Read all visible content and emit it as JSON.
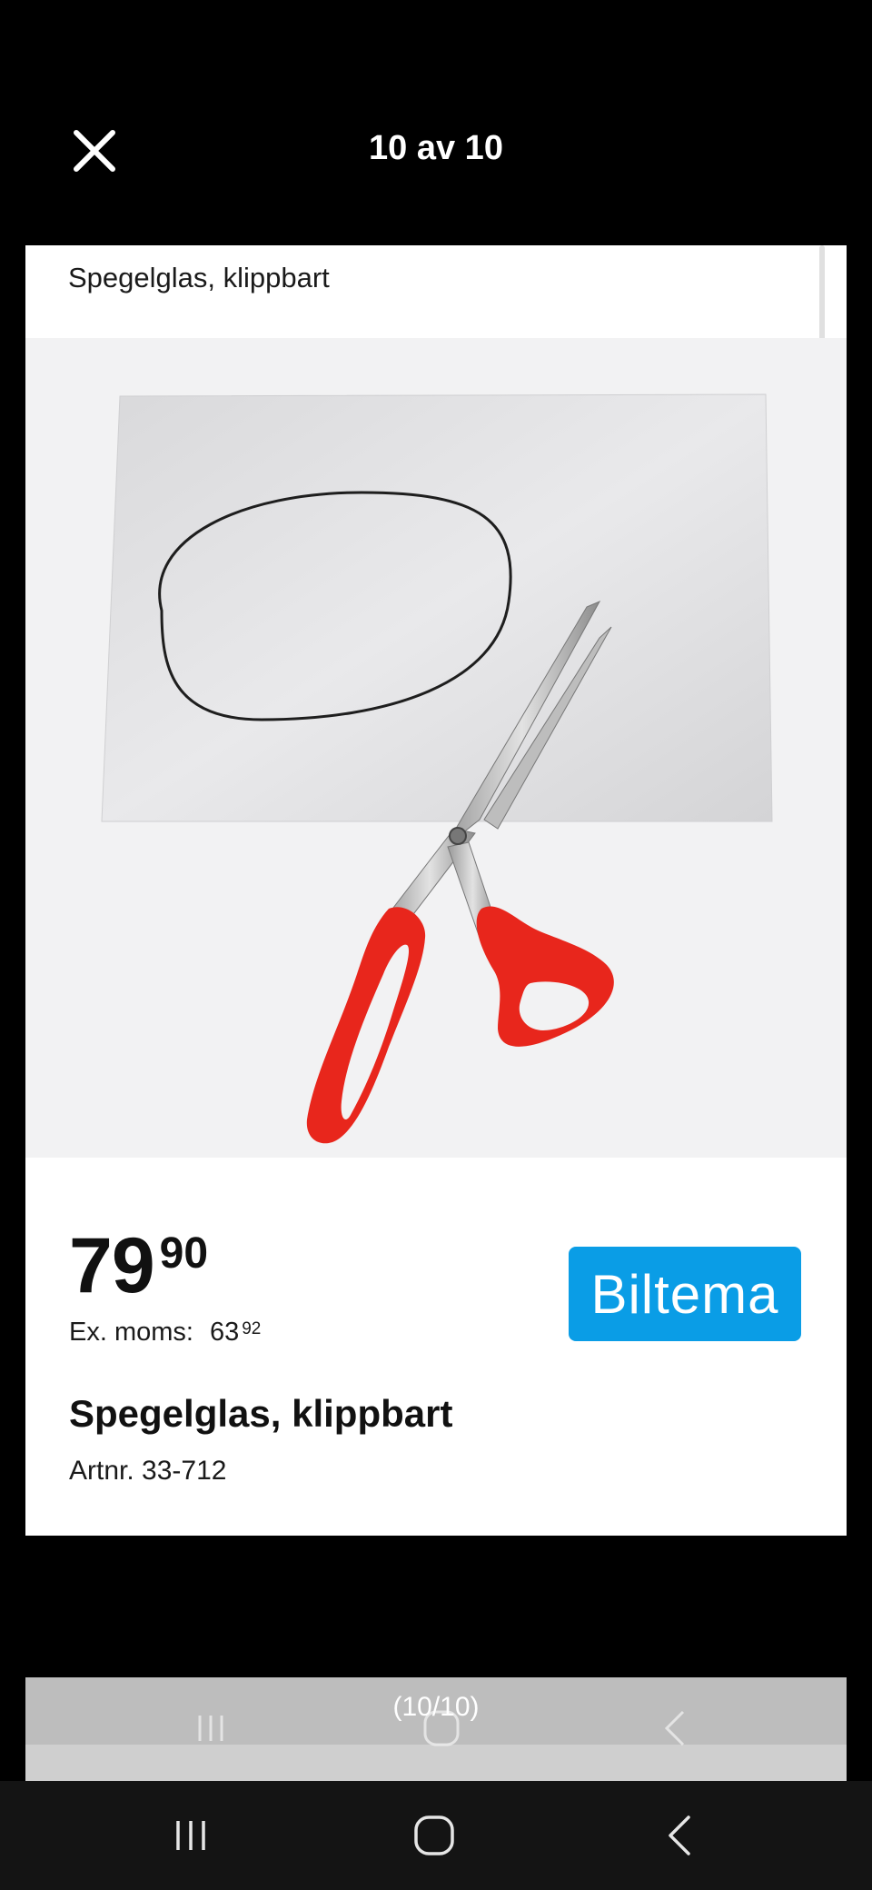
{
  "viewer": {
    "counter": "10 av 10"
  },
  "card": {
    "header_title": "Spegelglas, klippbart",
    "price": {
      "integer": "79",
      "decimal": "90"
    },
    "ex_moms": {
      "label": "Ex. moms:",
      "integer": "63",
      "decimal": "92"
    },
    "product_name": "Spegelglas, klippbart",
    "article_number": "Artnr. 33-712",
    "brand": "Biltema"
  },
  "peek": {
    "label": "(10/10)"
  },
  "colors": {
    "brand_blue": "#0a9de6",
    "scissors_red": "#e8261c",
    "background": "#000000"
  },
  "icons": {
    "close": "close-icon",
    "recents": "recents-icon",
    "home": "home-icon",
    "back": "back-icon"
  }
}
